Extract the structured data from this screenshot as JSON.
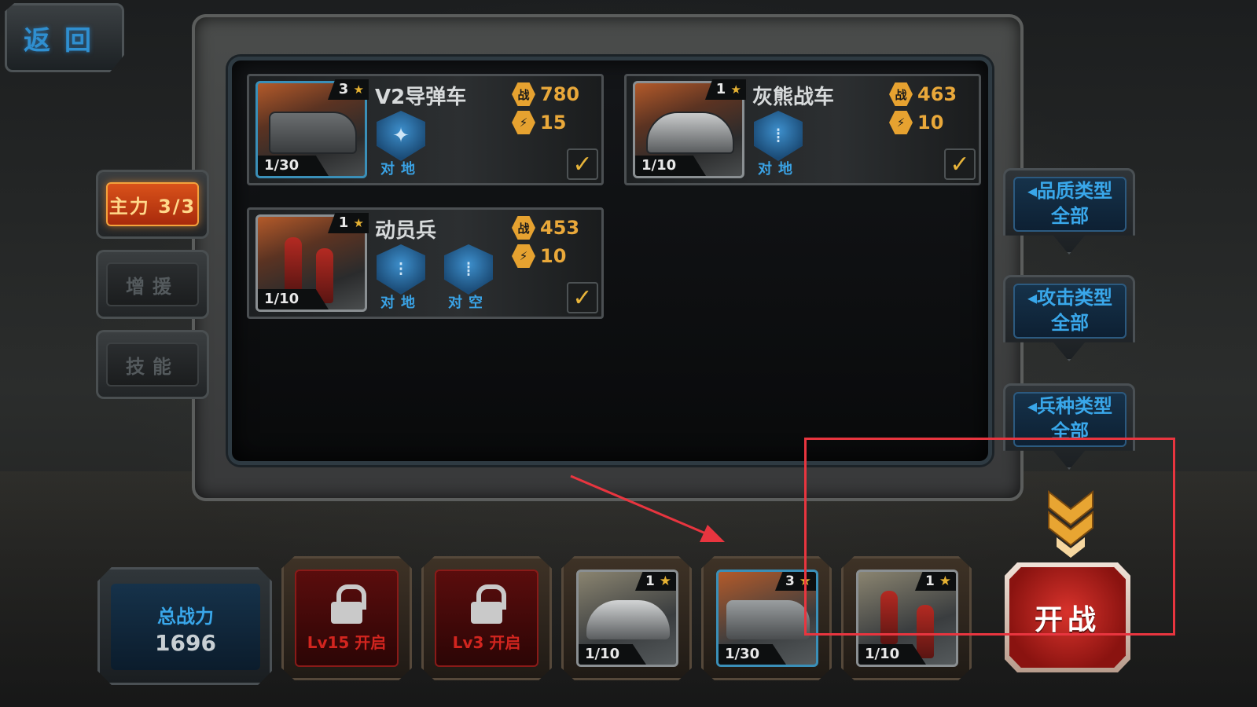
{
  "back_button": {
    "label": "返回"
  },
  "left_tabs": [
    {
      "id": "main",
      "label": "主力 3/3",
      "active": true
    },
    {
      "id": "support",
      "label": "增援",
      "active": false
    },
    {
      "id": "skill",
      "label": "技能",
      "active": false
    }
  ],
  "units": [
    {
      "name": "V2导弹车",
      "stars": "3",
      "count": "1/30",
      "power": "780",
      "cost": "15",
      "badges": [
        {
          "icon": "missile-icon",
          "label": "对地"
        }
      ],
      "checked": true
    },
    {
      "name": "灰熊战车",
      "stars": "1",
      "count": "1/10",
      "power": "463",
      "cost": "10",
      "badges": [
        {
          "icon": "shell-icon",
          "label": "对地"
        }
      ],
      "checked": true
    },
    {
      "name": "动员兵",
      "stars": "1",
      "count": "1/10",
      "power": "453",
      "cost": "10",
      "badges": [
        {
          "icon": "bullets-icon",
          "label": "对地"
        },
        {
          "icon": "shell-icon",
          "label": "对空"
        }
      ],
      "checked": true
    }
  ],
  "stat_icons": {
    "power": "战",
    "cost": "⚡"
  },
  "filters": [
    {
      "title": "◂品质类型",
      "value": "全部"
    },
    {
      "title": "◂攻击类型",
      "value": "全部"
    },
    {
      "title": "◂兵种类型",
      "value": "全部"
    }
  ],
  "total_power": {
    "label": "总战力",
    "value": "1696"
  },
  "slots": [
    {
      "type": "locked",
      "text": "Lv15 开启"
    },
    {
      "type": "locked",
      "text": "Lv3 开启"
    },
    {
      "type": "unit",
      "stars": "1",
      "count": "1/10",
      "unit": "灰熊战车"
    },
    {
      "type": "unit",
      "stars": "3",
      "count": "1/30",
      "unit": "V2导弹车"
    },
    {
      "type": "unit",
      "stars": "1",
      "count": "1/10",
      "unit": "动员兵"
    }
  ],
  "start_button": {
    "label": "开战"
  },
  "colors": {
    "accent_blue": "#39a7ea",
    "gold": "#e9a83a",
    "annotation_red": "#e8353f",
    "active_tab": "#d9521a"
  }
}
